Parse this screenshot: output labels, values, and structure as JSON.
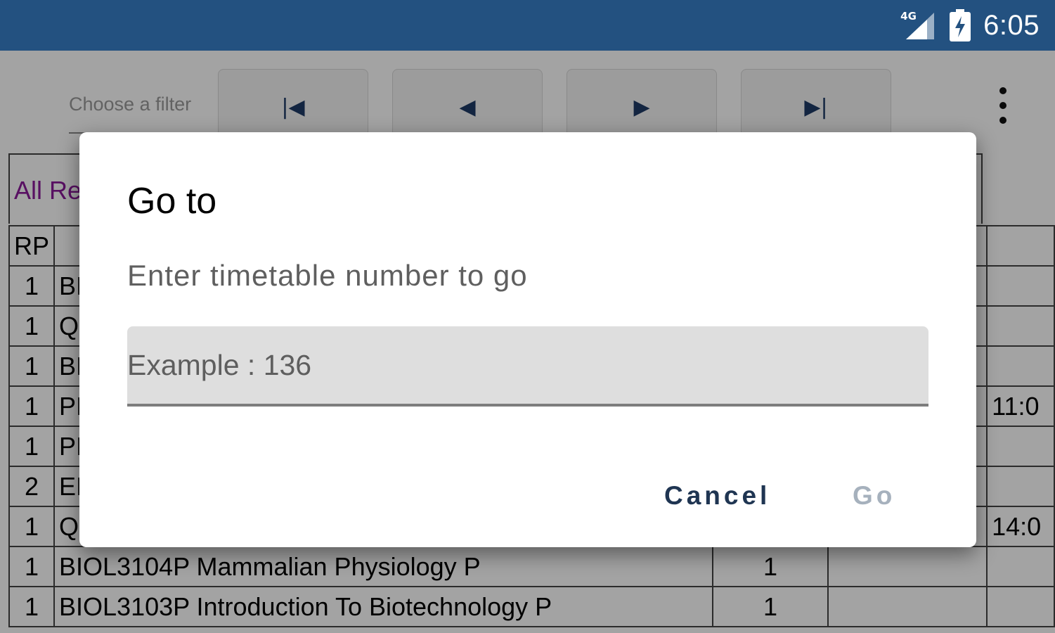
{
  "status_bar": {
    "network": "4G",
    "time": "6:05",
    "background_color": "#235180"
  },
  "toolbar": {
    "filter_placeholder": "Choose a filter",
    "buttons": [
      {
        "name": "first",
        "label": "|◀"
      },
      {
        "name": "previous",
        "label": "◀"
      },
      {
        "name": "next",
        "label": "▶"
      },
      {
        "name": "last",
        "label": "▶|"
      }
    ],
    "overflow_icon": "more-vert-icon"
  },
  "table": {
    "caption_partial": "All Re",
    "header_rp": "RP",
    "rows": [
      {
        "rp": "1",
        "course": "BI",
        "n": "",
        "t1": "",
        "t2": ""
      },
      {
        "rp": "1",
        "course": "Q",
        "n": "",
        "t1": "",
        "t2": ""
      },
      {
        "rp": "1",
        "course": "BI",
        "n": "",
        "t1": "",
        "t2": ""
      },
      {
        "rp": "1",
        "course": "PI",
        "n": "",
        "t1": "",
        "t2": "11:0"
      },
      {
        "rp": "1",
        "course": "PI",
        "n": "",
        "t1": "",
        "t2": ""
      },
      {
        "rp": "2",
        "course": "EI",
        "n": "",
        "t1": "",
        "t2": ""
      },
      {
        "rp": "1",
        "course": "Q",
        "n": "",
        "t1": "",
        "t2": "14:0"
      },
      {
        "rp": "1",
        "course": "BIOL3104P Mammalian Physiology P",
        "n": "1",
        "t1": "",
        "t2": ""
      },
      {
        "rp": "1",
        "course": "BIOL3103P Introduction To Biotechnology P",
        "n": "1",
        "t1": "",
        "t2": ""
      }
    ]
  },
  "dialog": {
    "title": "Go to",
    "message": "Enter timetable number to go",
    "input_placeholder": "Example : 136",
    "input_value": "",
    "cancel_label": "Cancel",
    "go_label": "Go",
    "cancel_color": "#1f3552",
    "go_color_disabled": "#a6b1bd"
  }
}
